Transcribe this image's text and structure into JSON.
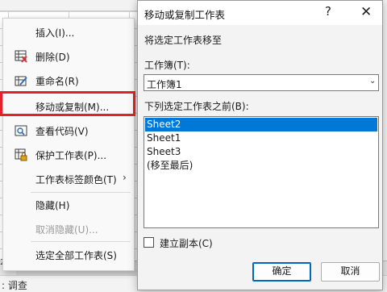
{
  "context_menu": {
    "items": [
      {
        "label": "插入(I)...",
        "icon": "none",
        "disabled": false
      },
      {
        "label": "删除(D)",
        "icon": "delete-sheet-icon",
        "disabled": false
      },
      {
        "label": "重命名(R)",
        "icon": "rename-icon",
        "disabled": false
      },
      {
        "label": "移动或复制(M)...",
        "icon": "none",
        "disabled": false
      },
      {
        "label": "查看代码(V)",
        "icon": "view-code-icon",
        "disabled": false
      },
      {
        "label": "保护工作表(P)...",
        "icon": "protect-sheet-icon",
        "disabled": false
      },
      {
        "label": "工作表标签颜色(T)",
        "icon": "none",
        "disabled": false,
        "submenu_arrow": "›"
      },
      {
        "label": "隐藏(H)",
        "icon": "none",
        "disabled": false
      },
      {
        "label": "取消隐藏(U)...",
        "icon": "none",
        "disabled": true
      },
      {
        "label": "选定全部工作表(S)",
        "icon": "none",
        "disabled": false
      }
    ],
    "highlight_color": "#e32128"
  },
  "dialog": {
    "title": "移动或复制工作表",
    "help_glyph": "?",
    "close_glyph": "✕",
    "move_label": "将选定工作表移至",
    "workbook_label": "工作簿(T):",
    "workbook_value": "工作簿1",
    "before_label": "下列选定工作表之前(B):",
    "sheets": [
      "Sheet2",
      "Sheet1",
      "Sheet3",
      "(移至最后)"
    ],
    "selected_sheet": "Sheet2",
    "copy_label": "建立副本(C)",
    "copy_checked": false,
    "ok_label": "确定",
    "cancel_label": "取消",
    "select_color": "#0078d7"
  },
  "statusbar": {
    "text": ": 调查"
  },
  "tabbar": {
    "number": "2"
  }
}
